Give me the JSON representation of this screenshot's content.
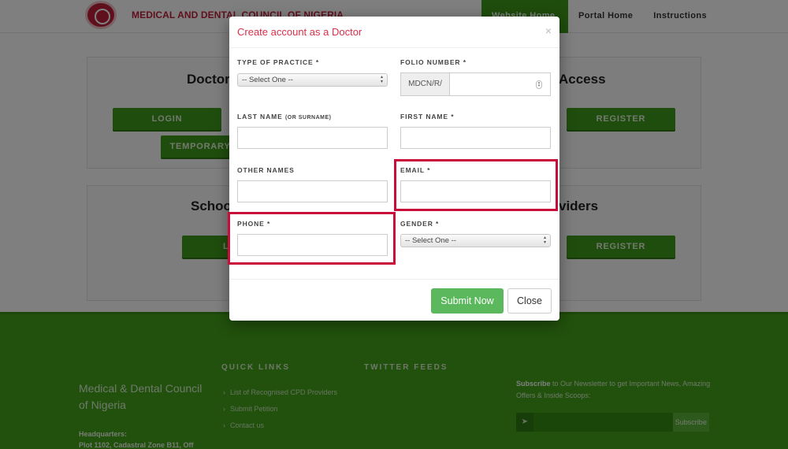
{
  "header": {
    "brand": "MEDICAL AND DENTAL COUNCIL OF NIGERIA",
    "nav": [
      {
        "label": "Website Home",
        "active": true
      },
      {
        "label": "Portal Home",
        "active": false
      },
      {
        "label": "Instructions",
        "active": false
      }
    ]
  },
  "panels": {
    "doctor": {
      "title": "Doctor",
      "login": "LOGIN",
      "temporary": "TEMPORARY"
    },
    "access": {
      "title": "Access",
      "register": "REGISTER"
    },
    "school": {
      "title": "Schoo",
      "login": "L"
    },
    "providers": {
      "title": "viders",
      "register": "REGISTER"
    }
  },
  "modal": {
    "title": "Create account as a Doctor",
    "close_icon": "×",
    "fields": {
      "type_of_practice": {
        "label": "TYPE OF PRACTICE",
        "required": "*",
        "value": "-- Select One --"
      },
      "folio_number": {
        "label": "FOLIO NUMBER",
        "required": "*",
        "prefix": "MDCN/R/",
        "value": ""
      },
      "last_name": {
        "label": "LAST NAME",
        "hint": "(OR SURNAME)",
        "value": ""
      },
      "first_name": {
        "label": "FIRST NAME",
        "required": "*",
        "value": ""
      },
      "other_names": {
        "label": "OTHER NAMES",
        "value": ""
      },
      "email": {
        "label": "EMAIL",
        "required": "*",
        "value": ""
      },
      "phone": {
        "label": "PHONE",
        "required": "*",
        "value": ""
      },
      "gender": {
        "label": "GENDER",
        "required": "*",
        "value": "-- Select One --"
      }
    },
    "submit": "Submit Now",
    "close": "Close"
  },
  "footer": {
    "org_name": "Medical & Dental Council of Nigeria",
    "hq_label": "Headquarters:",
    "hq_address": "Plot 1102, Cadastral Zone B11, Off",
    "quick_links_title": "QUICK LINKS",
    "quick_links": [
      "List of Recognised CPD Providers",
      "Submit Petition",
      "Contact us"
    ],
    "twitter_title": "TWITTER FEEDS",
    "subscribe_bold": "Subscribe",
    "subscribe_text": " to Our Newsletter to get Important News, Amazing Offers & Inside Scoops:",
    "subscribe_button": "Subscribe",
    "send_icon": "➤"
  },
  "colors": {
    "brand_red": "#c0203a",
    "nav_green": "#3f9a1a",
    "modal_title": "#d6304a",
    "highlight": "#c80d3a",
    "submit_green": "#5cb85c"
  }
}
